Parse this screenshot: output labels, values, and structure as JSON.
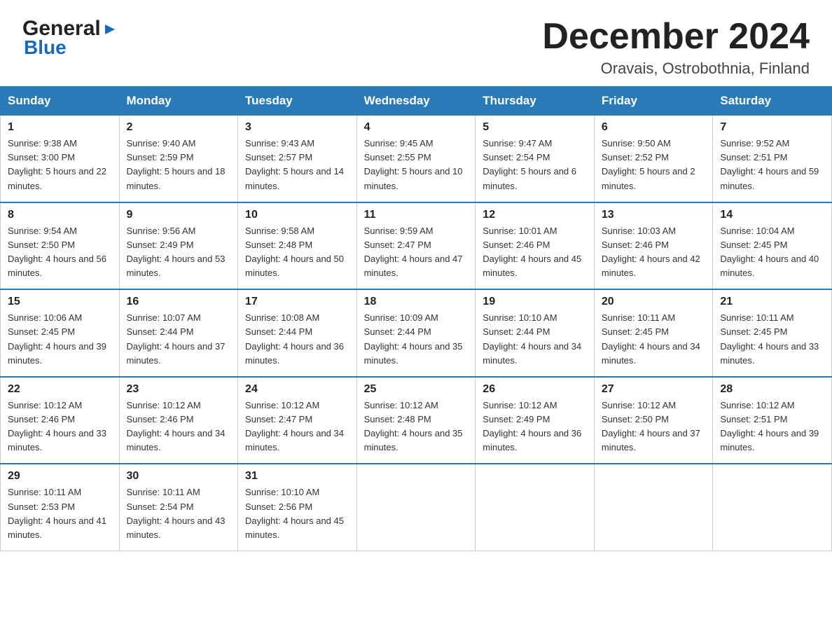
{
  "logo": {
    "general": "General",
    "triangle": "▶",
    "blue": "Blue"
  },
  "header": {
    "month_title": "December 2024",
    "location": "Oravais, Ostrobothnia, Finland"
  },
  "days_of_week": [
    "Sunday",
    "Monday",
    "Tuesday",
    "Wednesday",
    "Thursday",
    "Friday",
    "Saturday"
  ],
  "weeks": [
    [
      {
        "day": "1",
        "sunrise": "Sunrise: 9:38 AM",
        "sunset": "Sunset: 3:00 PM",
        "daylight": "Daylight: 5 hours and 22 minutes."
      },
      {
        "day": "2",
        "sunrise": "Sunrise: 9:40 AM",
        "sunset": "Sunset: 2:59 PM",
        "daylight": "Daylight: 5 hours and 18 minutes."
      },
      {
        "day": "3",
        "sunrise": "Sunrise: 9:43 AM",
        "sunset": "Sunset: 2:57 PM",
        "daylight": "Daylight: 5 hours and 14 minutes."
      },
      {
        "day": "4",
        "sunrise": "Sunrise: 9:45 AM",
        "sunset": "Sunset: 2:55 PM",
        "daylight": "Daylight: 5 hours and 10 minutes."
      },
      {
        "day": "5",
        "sunrise": "Sunrise: 9:47 AM",
        "sunset": "Sunset: 2:54 PM",
        "daylight": "Daylight: 5 hours and 6 minutes."
      },
      {
        "day": "6",
        "sunrise": "Sunrise: 9:50 AM",
        "sunset": "Sunset: 2:52 PM",
        "daylight": "Daylight: 5 hours and 2 minutes."
      },
      {
        "day": "7",
        "sunrise": "Sunrise: 9:52 AM",
        "sunset": "Sunset: 2:51 PM",
        "daylight": "Daylight: 4 hours and 59 minutes."
      }
    ],
    [
      {
        "day": "8",
        "sunrise": "Sunrise: 9:54 AM",
        "sunset": "Sunset: 2:50 PM",
        "daylight": "Daylight: 4 hours and 56 minutes."
      },
      {
        "day": "9",
        "sunrise": "Sunrise: 9:56 AM",
        "sunset": "Sunset: 2:49 PM",
        "daylight": "Daylight: 4 hours and 53 minutes."
      },
      {
        "day": "10",
        "sunrise": "Sunrise: 9:58 AM",
        "sunset": "Sunset: 2:48 PM",
        "daylight": "Daylight: 4 hours and 50 minutes."
      },
      {
        "day": "11",
        "sunrise": "Sunrise: 9:59 AM",
        "sunset": "Sunset: 2:47 PM",
        "daylight": "Daylight: 4 hours and 47 minutes."
      },
      {
        "day": "12",
        "sunrise": "Sunrise: 10:01 AM",
        "sunset": "Sunset: 2:46 PM",
        "daylight": "Daylight: 4 hours and 45 minutes."
      },
      {
        "day": "13",
        "sunrise": "Sunrise: 10:03 AM",
        "sunset": "Sunset: 2:46 PM",
        "daylight": "Daylight: 4 hours and 42 minutes."
      },
      {
        "day": "14",
        "sunrise": "Sunrise: 10:04 AM",
        "sunset": "Sunset: 2:45 PM",
        "daylight": "Daylight: 4 hours and 40 minutes."
      }
    ],
    [
      {
        "day": "15",
        "sunrise": "Sunrise: 10:06 AM",
        "sunset": "Sunset: 2:45 PM",
        "daylight": "Daylight: 4 hours and 39 minutes."
      },
      {
        "day": "16",
        "sunrise": "Sunrise: 10:07 AM",
        "sunset": "Sunset: 2:44 PM",
        "daylight": "Daylight: 4 hours and 37 minutes."
      },
      {
        "day": "17",
        "sunrise": "Sunrise: 10:08 AM",
        "sunset": "Sunset: 2:44 PM",
        "daylight": "Daylight: 4 hours and 36 minutes."
      },
      {
        "day": "18",
        "sunrise": "Sunrise: 10:09 AM",
        "sunset": "Sunset: 2:44 PM",
        "daylight": "Daylight: 4 hours and 35 minutes."
      },
      {
        "day": "19",
        "sunrise": "Sunrise: 10:10 AM",
        "sunset": "Sunset: 2:44 PM",
        "daylight": "Daylight: 4 hours and 34 minutes."
      },
      {
        "day": "20",
        "sunrise": "Sunrise: 10:11 AM",
        "sunset": "Sunset: 2:45 PM",
        "daylight": "Daylight: 4 hours and 34 minutes."
      },
      {
        "day": "21",
        "sunrise": "Sunrise: 10:11 AM",
        "sunset": "Sunset: 2:45 PM",
        "daylight": "Daylight: 4 hours and 33 minutes."
      }
    ],
    [
      {
        "day": "22",
        "sunrise": "Sunrise: 10:12 AM",
        "sunset": "Sunset: 2:46 PM",
        "daylight": "Daylight: 4 hours and 33 minutes."
      },
      {
        "day": "23",
        "sunrise": "Sunrise: 10:12 AM",
        "sunset": "Sunset: 2:46 PM",
        "daylight": "Daylight: 4 hours and 34 minutes."
      },
      {
        "day": "24",
        "sunrise": "Sunrise: 10:12 AM",
        "sunset": "Sunset: 2:47 PM",
        "daylight": "Daylight: 4 hours and 34 minutes."
      },
      {
        "day": "25",
        "sunrise": "Sunrise: 10:12 AM",
        "sunset": "Sunset: 2:48 PM",
        "daylight": "Daylight: 4 hours and 35 minutes."
      },
      {
        "day": "26",
        "sunrise": "Sunrise: 10:12 AM",
        "sunset": "Sunset: 2:49 PM",
        "daylight": "Daylight: 4 hours and 36 minutes."
      },
      {
        "day": "27",
        "sunrise": "Sunrise: 10:12 AM",
        "sunset": "Sunset: 2:50 PM",
        "daylight": "Daylight: 4 hours and 37 minutes."
      },
      {
        "day": "28",
        "sunrise": "Sunrise: 10:12 AM",
        "sunset": "Sunset: 2:51 PM",
        "daylight": "Daylight: 4 hours and 39 minutes."
      }
    ],
    [
      {
        "day": "29",
        "sunrise": "Sunrise: 10:11 AM",
        "sunset": "Sunset: 2:53 PM",
        "daylight": "Daylight: 4 hours and 41 minutes."
      },
      {
        "day": "30",
        "sunrise": "Sunrise: 10:11 AM",
        "sunset": "Sunset: 2:54 PM",
        "daylight": "Daylight: 4 hours and 43 minutes."
      },
      {
        "day": "31",
        "sunrise": "Sunrise: 10:10 AM",
        "sunset": "Sunset: 2:56 PM",
        "daylight": "Daylight: 4 hours and 45 minutes."
      },
      null,
      null,
      null,
      null
    ]
  ]
}
